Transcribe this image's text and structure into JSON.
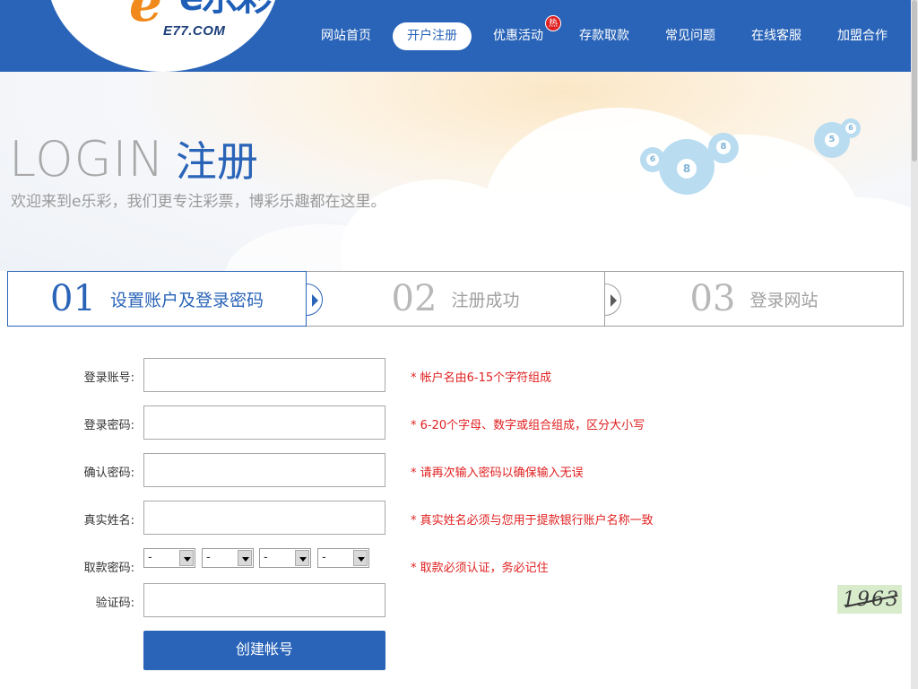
{
  "header": {
    "logo_text": "e乐彩",
    "logo_sub": "E77.COM",
    "nav": [
      {
        "label": "网站首页",
        "active": false
      },
      {
        "label": "开户注册",
        "active": true
      },
      {
        "label": "优惠活动",
        "active": false,
        "badge": "热"
      },
      {
        "label": "存款取款",
        "active": false
      },
      {
        "label": "常见问题",
        "active": false
      },
      {
        "label": "在线客服",
        "active": false
      },
      {
        "label": "加盟合作",
        "active": false
      }
    ]
  },
  "banner": {
    "title_en": "LOGIN",
    "title_cn": "注册",
    "subtitle": "欢迎来到e乐彩，我们更专注彩票，博彩乐趣都在这里。",
    "balls": [
      "8",
      "8",
      "6",
      "5",
      "6"
    ]
  },
  "steps": [
    {
      "num": "01",
      "label": "设置账户及登录密码",
      "active": true
    },
    {
      "num": "02",
      "label": "注册成功",
      "active": false
    },
    {
      "num": "03",
      "label": "登录网站",
      "active": false
    }
  ],
  "form": {
    "fields": [
      {
        "label": "登录账号:",
        "value": "",
        "hint": "* 帐户名由6-15个字符组成"
      },
      {
        "label": "登录密码:",
        "value": "",
        "hint": "* 6-20个字母、数字或组合组成，区分大小写"
      },
      {
        "label": "确认密码:",
        "value": "",
        "hint": "* 请再次输入密码以确保输入无误"
      },
      {
        "label": "真实姓名:",
        "value": "",
        "hint": "* 真实姓名必须与您用于提款银行账户名称一致"
      }
    ],
    "withdraw": {
      "label": "取款密码:",
      "selects": [
        "-",
        "-",
        "-",
        "-"
      ],
      "hint": "* 取款必须认证，务必记住"
    },
    "captcha": {
      "label": "验证码:",
      "value": "",
      "image_text": "1963"
    },
    "submit_label": "创建帐号"
  },
  "colors": {
    "brand": "#2a64b8",
    "hint": "#e02020",
    "logo_orange": "#f08a1c"
  }
}
